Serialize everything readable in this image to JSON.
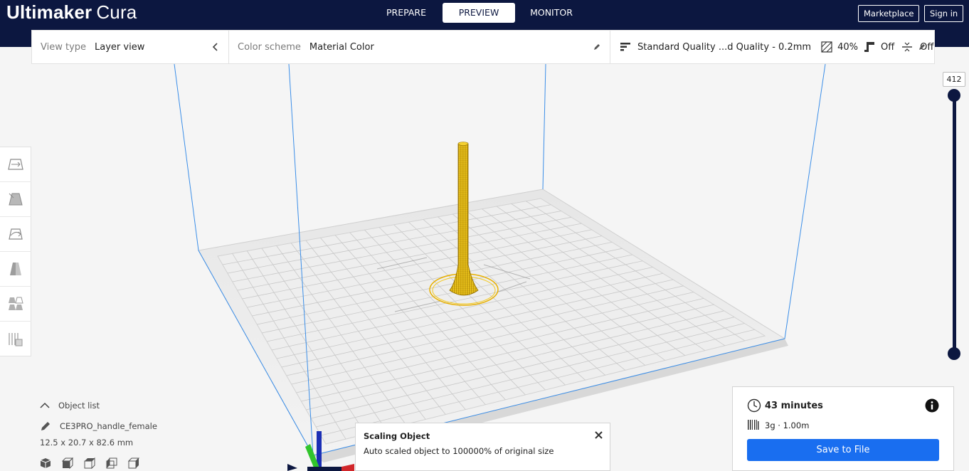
{
  "app": {
    "brand_bold": "Ultimaker",
    "brand_thin": "Cura"
  },
  "stages": [
    {
      "label": "PREPARE",
      "active": false
    },
    {
      "label": "PREVIEW",
      "active": true
    },
    {
      "label": "MONITOR",
      "active": false
    }
  ],
  "header": {
    "marketplace": "Marketplace",
    "sign_in": "Sign in"
  },
  "view": {
    "view_type_label": "View type",
    "view_type_value": "Layer view",
    "color_scheme_label": "Color scheme",
    "color_scheme_value": "Material Color",
    "profile": "Standard Quality ...d Quality - 0.2mm",
    "infill": "40%",
    "support": "Off",
    "adhesion": "Off"
  },
  "layer_slider": {
    "max_layer": "412"
  },
  "object_list": {
    "title": "Object list",
    "object_name": "CE3PRO_handle_female",
    "dimensions": "12.5 x 20.7 x 82.6 mm"
  },
  "toast": {
    "title": "Scaling Object",
    "message": "Auto scaled object to 100000% of original size"
  },
  "print_info": {
    "time": "43 minutes",
    "material": "3g · 1.00m",
    "save_button": "Save to File"
  },
  "colors": {
    "header": "#0c1740",
    "accent": "#196ef0",
    "model": "#f4c81a",
    "build_volume": "#3b8ee8"
  }
}
